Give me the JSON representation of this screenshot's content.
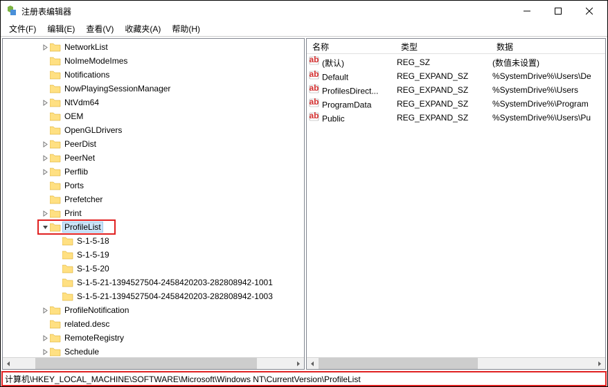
{
  "window": {
    "title": "注册表编辑器"
  },
  "menu": {
    "items": [
      "文件(F)",
      "编辑(E)",
      "查看(V)",
      "收藏夹(A)",
      "帮助(H)"
    ]
  },
  "tree": {
    "items": [
      {
        "label": "NetworkList",
        "indent": 3,
        "exp": ">"
      },
      {
        "label": "NoImeModeImes",
        "indent": 3,
        "exp": ""
      },
      {
        "label": "Notifications",
        "indent": 3,
        "exp": ""
      },
      {
        "label": "NowPlayingSessionManager",
        "indent": 3,
        "exp": ""
      },
      {
        "label": "NtVdm64",
        "indent": 3,
        "exp": ">"
      },
      {
        "label": "OEM",
        "indent": 3,
        "exp": ""
      },
      {
        "label": "OpenGLDrivers",
        "indent": 3,
        "exp": ""
      },
      {
        "label": "PeerDist",
        "indent": 3,
        "exp": ">"
      },
      {
        "label": "PeerNet",
        "indent": 3,
        "exp": ">"
      },
      {
        "label": "Perflib",
        "indent": 3,
        "exp": ">"
      },
      {
        "label": "Ports",
        "indent": 3,
        "exp": ""
      },
      {
        "label": "Prefetcher",
        "indent": 3,
        "exp": ""
      },
      {
        "label": "Print",
        "indent": 3,
        "exp": ">"
      },
      {
        "label": "ProfileList",
        "indent": 3,
        "exp": "v",
        "selected": true
      },
      {
        "label": "S-1-5-18",
        "indent": 4,
        "exp": ""
      },
      {
        "label": "S-1-5-19",
        "indent": 4,
        "exp": ""
      },
      {
        "label": "S-1-5-20",
        "indent": 4,
        "exp": ""
      },
      {
        "label": "S-1-5-21-1394527504-2458420203-282808942-1001",
        "indent": 4,
        "exp": ""
      },
      {
        "label": "S-1-5-21-1394527504-2458420203-282808942-1003",
        "indent": 4,
        "exp": ""
      },
      {
        "label": "ProfileNotification",
        "indent": 3,
        "exp": ">"
      },
      {
        "label": "related.desc",
        "indent": 3,
        "exp": ""
      },
      {
        "label": "RemoteRegistry",
        "indent": 3,
        "exp": ">"
      },
      {
        "label": "Schedule",
        "indent": 3,
        "exp": ">"
      }
    ]
  },
  "list": {
    "headers": {
      "name": "名称",
      "type": "类型",
      "data": "数据"
    },
    "rows": [
      {
        "name": "(默认)",
        "type": "REG_SZ",
        "data": "(数值未设置)"
      },
      {
        "name": "Default",
        "type": "REG_EXPAND_SZ",
        "data": "%SystemDrive%\\Users\\De"
      },
      {
        "name": "ProfilesDirect...",
        "type": "REG_EXPAND_SZ",
        "data": "%SystemDrive%\\Users"
      },
      {
        "name": "ProgramData",
        "type": "REG_EXPAND_SZ",
        "data": "%SystemDrive%\\Program"
      },
      {
        "name": "Public",
        "type": "REG_EXPAND_SZ",
        "data": "%SystemDrive%\\Users\\Pu"
      }
    ]
  },
  "statusbar": {
    "path": "计算机\\HKEY_LOCAL_MACHINE\\SOFTWARE\\Microsoft\\Windows NT\\CurrentVersion\\ProfileList"
  }
}
